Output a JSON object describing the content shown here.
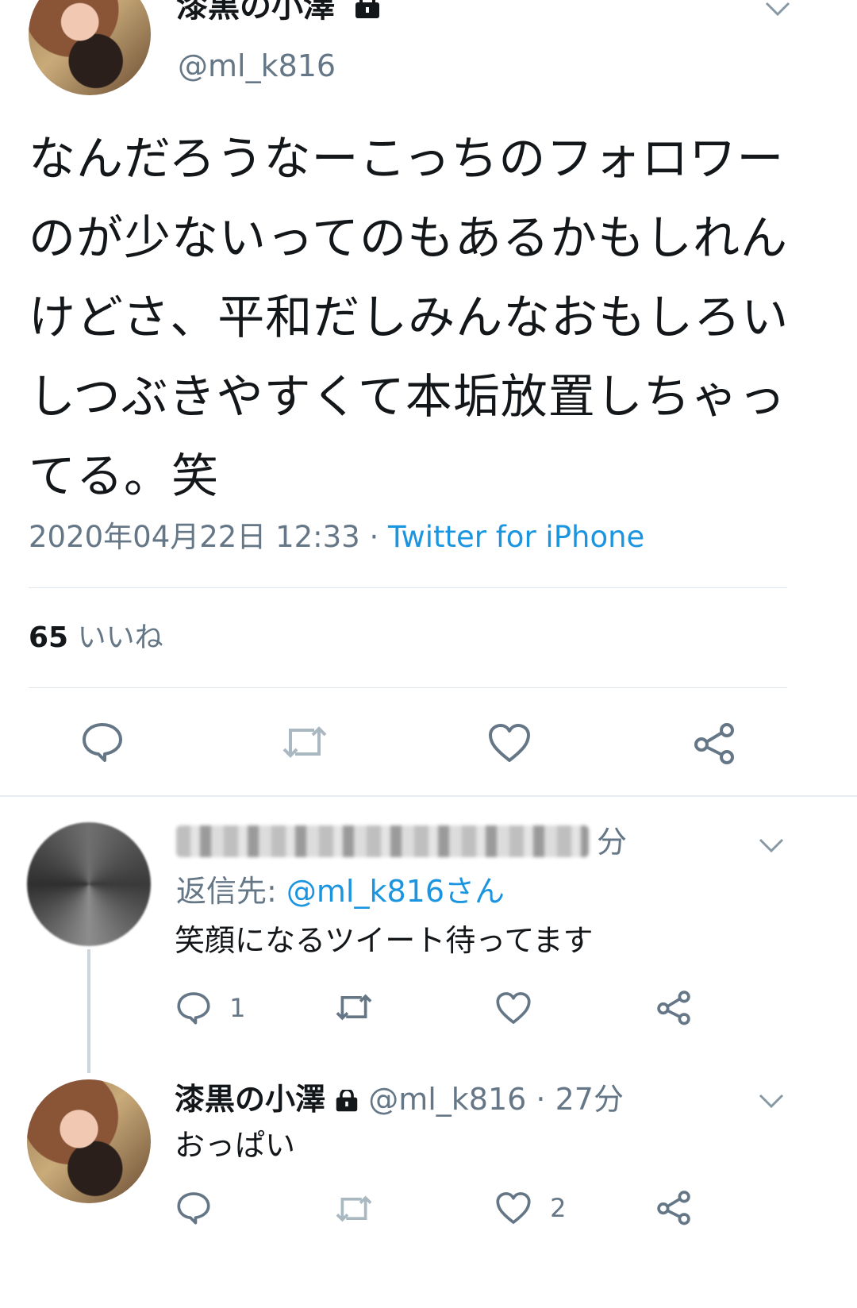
{
  "main_tweet": {
    "display_name": "漆黒の小澤",
    "handle": "@ml_k816",
    "text": "なんだろうなーこっちのフォロワーのが少ないってのもあるかもしれんけどさ、平和だしみんなおもしろいしつぶきやすくて本垢放置しちゃってる。笑",
    "timestamp": "2020年04月22日 12:33",
    "separator": "·",
    "source": "Twitter for iPhone",
    "like_count": "65",
    "like_label": "いいね"
  },
  "reply_1": {
    "time_suffix": "分",
    "reply_to_prefix": "返信先:",
    "reply_to_handle": "@ml_k816さん",
    "text": "笑顔になるツイート待ってます",
    "reply_count": "1"
  },
  "reply_2": {
    "display_name": "漆黒の小澤",
    "handle": "@ml_k816",
    "separator": "·",
    "time": "27分",
    "text": "おっぱい",
    "like_count": "2"
  },
  "icons": [
    "lock-icon",
    "chevron-down-icon",
    "reply-icon",
    "retweet-icon",
    "like-icon",
    "share-icon"
  ],
  "colors": {
    "text": "#14171a",
    "muted": "#657786",
    "link": "#1b95e0",
    "divider": "#e1e8ed"
  }
}
